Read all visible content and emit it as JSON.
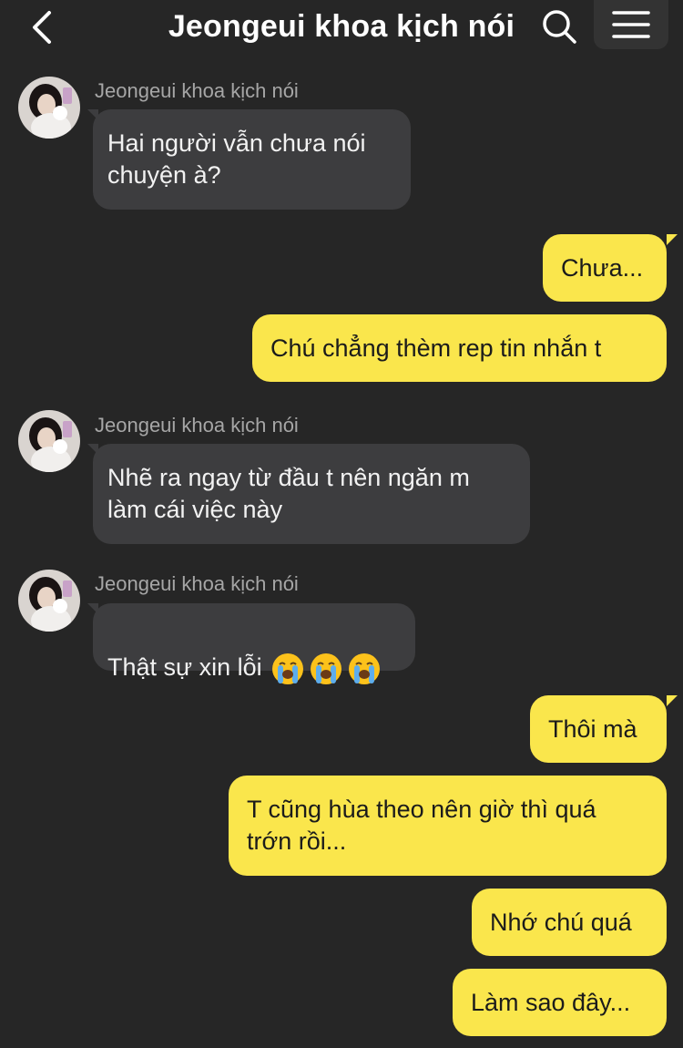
{
  "header": {
    "title": "Jeongeui khoa kịch nói",
    "back_icon": "chevron-left-icon",
    "search_icon": "search-icon",
    "menu_icon": "hamburger-menu-icon"
  },
  "colors": {
    "background": "#262626",
    "incoming_bubble": "#3d3d3f",
    "outgoing_bubble": "#fae64c",
    "sender_name": "#a6a6a6"
  },
  "messages": [
    {
      "direction": "in",
      "sender": "Jeongeui khoa kịch nói",
      "text": "Hai người vẫn chưa nói\nchuyện à?"
    },
    {
      "direction": "out",
      "text": "Chưa..."
    },
    {
      "direction": "out",
      "text": "Chú chẳng thèm rep tin nhắn t"
    },
    {
      "direction": "in",
      "sender": "Jeongeui khoa kịch nói",
      "text": "Nhẽ ra ngay từ đầu t nên ngăn m\nlàm cái việc này"
    },
    {
      "direction": "in",
      "sender": "Jeongeui khoa kịch nói",
      "text": "Thật sự xin lỗi",
      "emojis": [
        "loudly-crying-face",
        "loudly-crying-face",
        "loudly-crying-face"
      ]
    },
    {
      "direction": "out",
      "text": "Thôi mà"
    },
    {
      "direction": "out",
      "text": "T cũng hùa theo nên giờ thì quá\ntrớn rồi..."
    },
    {
      "direction": "out",
      "text": "Nhớ chú quá"
    },
    {
      "direction": "out",
      "text": "Làm sao đây..."
    }
  ]
}
